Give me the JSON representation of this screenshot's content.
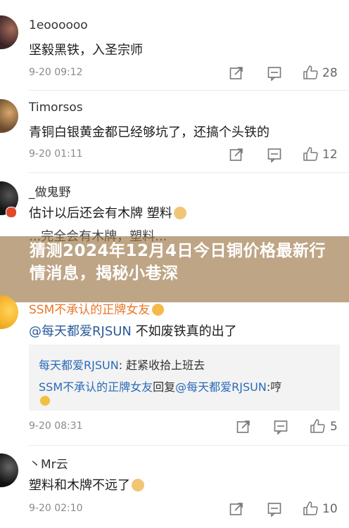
{
  "comments": [
    {
      "username": "1eoooooo",
      "text": "坚毅黑铁，入圣宗师",
      "time": "9-20 09:12",
      "likes": "28"
    },
    {
      "username": "Timorsos",
      "text": "青铜白银黄金都已经够坑了，还搞个头铁的",
      "time": "9-20 01:11",
      "likes": "12"
    },
    {
      "username": "_做鬼野",
      "text": "估计以后还会有木牌 塑料",
      "time": "",
      "likes": ""
    },
    {
      "username": "SSM不承认的正牌女友",
      "text_mention": "@每天都爱RJSUN",
      "text_rest": " 不如废铁真的出了",
      "time": "9-20 08:31",
      "likes": "5",
      "replies": [
        {
          "author": "每天都爱RJSUN",
          "sep": ": ",
          "text": "赶紧收拾上班去"
        },
        {
          "author": "SSM不承认的正牌女友",
          "verb": "回复",
          "target": "@每天都爱RJSUN",
          "sep": ":",
          "text": "哼"
        }
      ]
    },
    {
      "username": "丶Mr云",
      "text": "塑料和木牌不远了",
      "time": "9-20 02:10",
      "likes": "10"
    }
  ],
  "overlap_text": "...完全会有木牌，塑料...",
  "banner": {
    "title": "猜测2024年12月4日今日铜价格最新行情消息，揭秘小巷深"
  },
  "icons": {
    "share": "share-icon",
    "comment": "comment-icon",
    "like": "thumbs-up-icon"
  },
  "colors": {
    "orange_username": "#e8782a",
    "mention_blue": "#2a6ab8",
    "banner_overlay": "#966e3c"
  }
}
